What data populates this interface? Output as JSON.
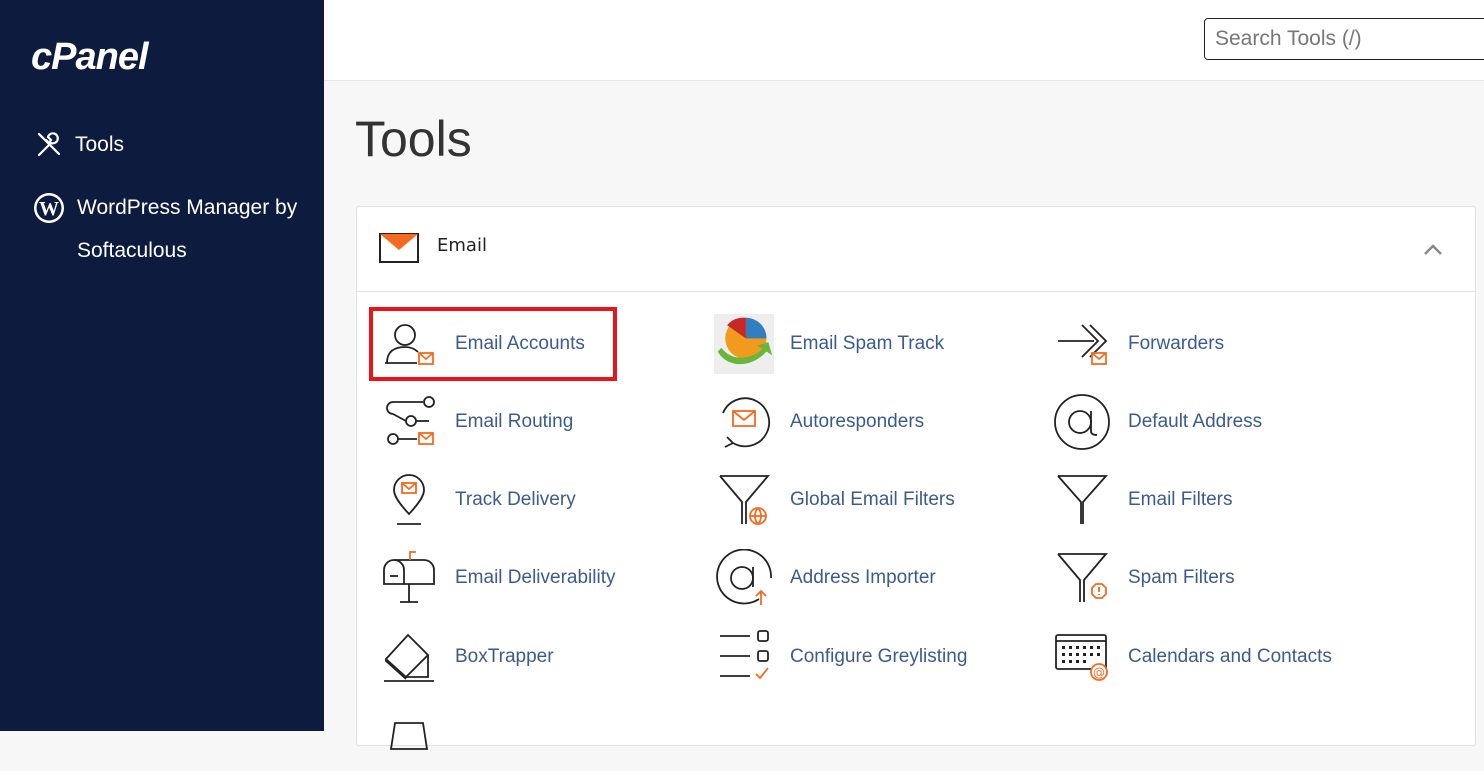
{
  "app": {
    "logo": "cPanel"
  },
  "sidebar": {
    "items": [
      {
        "label": "Tools",
        "icon": "tools-icon"
      },
      {
        "label": "WordPress Manager by Softaculous",
        "icon": "wordpress-icon"
      }
    ]
  },
  "header": {
    "search_placeholder": "Search Tools (/)"
  },
  "main": {
    "title": "Tools",
    "section": {
      "title": "Email",
      "icon": "envelope-icon",
      "collapse_icon": "chevron-up-icon",
      "tools": [
        {
          "label": "Email Accounts",
          "icon": "email-accounts-icon"
        },
        {
          "label": "Email Spam Track",
          "icon": "spam-track-icon"
        },
        {
          "label": "Forwarders",
          "icon": "forwarders-icon"
        },
        {
          "label": "Email Routing",
          "icon": "email-routing-icon"
        },
        {
          "label": "Autoresponders",
          "icon": "autoresponders-icon"
        },
        {
          "label": "Default Address",
          "icon": "default-address-icon"
        },
        {
          "label": "Track Delivery",
          "icon": "track-delivery-icon"
        },
        {
          "label": "Global Email Filters",
          "icon": "global-filters-icon"
        },
        {
          "label": "Email Filters",
          "icon": "email-filters-icon"
        },
        {
          "label": "Email Deliverability",
          "icon": "mailbox-icon"
        },
        {
          "label": "Address Importer",
          "icon": "address-importer-icon"
        },
        {
          "label": "Spam Filters",
          "icon": "spam-filters-icon"
        },
        {
          "label": "BoxTrapper",
          "icon": "boxtrapper-icon"
        },
        {
          "label": "Configure Greylisting",
          "icon": "greylisting-icon"
        },
        {
          "label": "Calendars and Contacts",
          "icon": "calendar-icon"
        }
      ]
    }
  },
  "colors": {
    "sidebar_bg": "#0d1b3e",
    "accent_orange": "#f26b21",
    "link": "#3b5b8f",
    "highlight": "#e8131d"
  }
}
